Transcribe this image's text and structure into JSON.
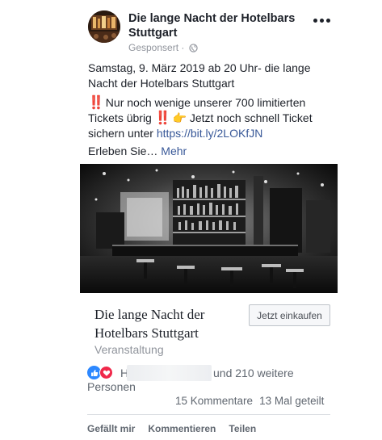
{
  "header": {
    "page_name": "Die lange Nacht der Hotelbars Stuttgart",
    "sponsored_label": "Gesponsert",
    "separator": "·",
    "privacy_icon": "globe-icon",
    "more_icon": "more-horizontal-icon"
  },
  "body": {
    "line1": "Samstag, 9. März 2019 ab 20 Uhr- die lange Nacht der Hotelbars Stuttgart",
    "bang_emoji": "‼️",
    "line2_a": " Nur noch wenige unserer 700 limitierten Tickets übrig ",
    "hand_emoji": "👉",
    "line2_b": " Jetzt noch schnell Ticket sichern unter ",
    "link_text": "https://bit.ly/2LOKfJN",
    "line3": "Erleben Sie… ",
    "more_link": "Mehr"
  },
  "link_card": {
    "title": "Die lange Nacht der Hotelbars Stuttgart",
    "subtitle": "Veranstaltung",
    "cta_label": "Jetzt einkaufen"
  },
  "reactions": {
    "icons": [
      "like-icon",
      "love-icon"
    ],
    "first_name_initial": "H",
    "others_text": "und 210 weitere",
    "others_text_2": "Personen",
    "comments": "15 Kommentare",
    "shares": "13 Mal geteilt"
  },
  "actions": {
    "like": "Gefällt mir",
    "comment": "Kommentieren",
    "share": "Teilen"
  },
  "colors": {
    "link": "#385898",
    "like_blue": "#2d88ff",
    "love_red": "#f0284a",
    "secondary_text": "#90949c"
  }
}
